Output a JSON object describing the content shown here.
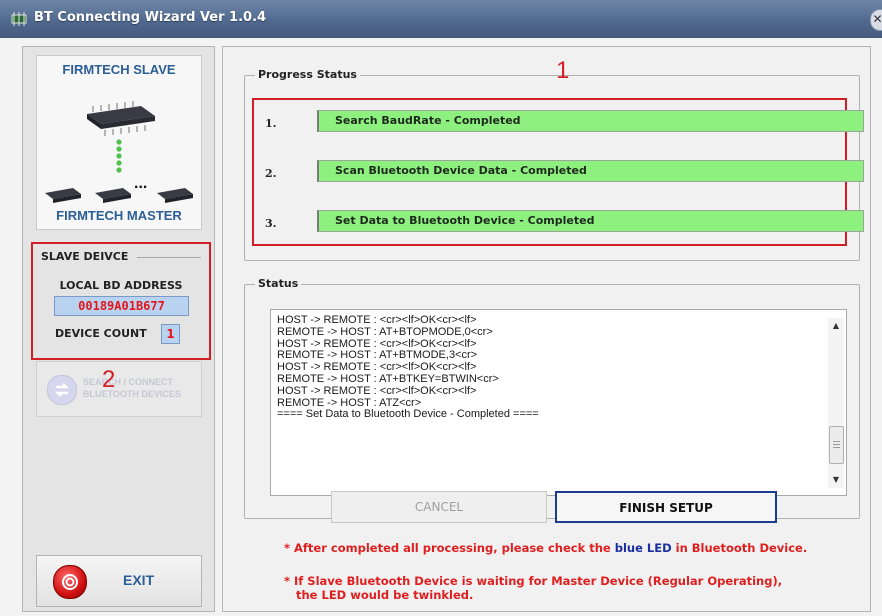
{
  "window": {
    "title": "BT Connecting Wizard Ver 1.0.4",
    "close_glyph": "✕"
  },
  "left": {
    "topology": {
      "slave_label": "FIRMTECH SLAVE",
      "master_label": "FIRMTECH MASTER",
      "dots": "..."
    },
    "slave_device": {
      "legend": "SLAVE DEIVCE",
      "bd_address_label": "LOCAL BD ADDRESS",
      "bd_address": "00189A01B677",
      "device_count_label": "DEVICE COUNT",
      "device_count": "1"
    },
    "search_button": {
      "line1": "SEARCH / CONNECT",
      "line2": "BLUETOOTH DEVICES"
    },
    "marker": "2",
    "exit_label": "EXIT"
  },
  "progress": {
    "legend": "Progress Status",
    "marker": "1",
    "steps": [
      {
        "num": "1.",
        "label": "Search BaudRate - Completed",
        "progress": 1.0
      },
      {
        "num": "2.",
        "label": "Scan Bluetooth Device Data - Completed",
        "progress": 1.0
      },
      {
        "num": "3.",
        "label": "Set Data to Bluetooth Device - Completed",
        "progress": 1.0
      }
    ]
  },
  "status": {
    "legend": "Status",
    "lines": [
      "HOST -> REMOTE : <cr><lf>OK<cr><lf>",
      "REMOTE -> HOST : AT+BTOPMODE,0<cr>",
      "HOST -> REMOTE : <cr><lf>OK<cr><lf>",
      "REMOTE -> HOST : AT+BTMODE,3<cr>",
      "HOST -> REMOTE : <cr><lf>OK<cr><lf>",
      "REMOTE -> HOST : AT+BTKEY=BTWIN<cr>",
      "HOST -> REMOTE : <cr><lf>OK<cr><lf>",
      "REMOTE -> HOST : ATZ<cr>",
      "==== Set Data to Bluetooth Device - Completed ===="
    ]
  },
  "buttons": {
    "cancel": "CANCEL",
    "finish": "FINISH SETUP"
  },
  "notes": {
    "note1_before": "* After completed all processing, please check the ",
    "note1_blue": "blue LED",
    "note1_after": " in Bluetooth Device.",
    "note2_line1": "* If Slave Bluetooth Device is waiting for Master Device (Regular Operating),",
    "note2_line2": "the LED would be twinkled."
  },
  "colors": {
    "step_fill": "#8df07f",
    "highlight": "#d21f26",
    "note_red": "#df1f1f",
    "note_blue": "#1b2fa0",
    "finish_border": "#1c3d8f"
  }
}
